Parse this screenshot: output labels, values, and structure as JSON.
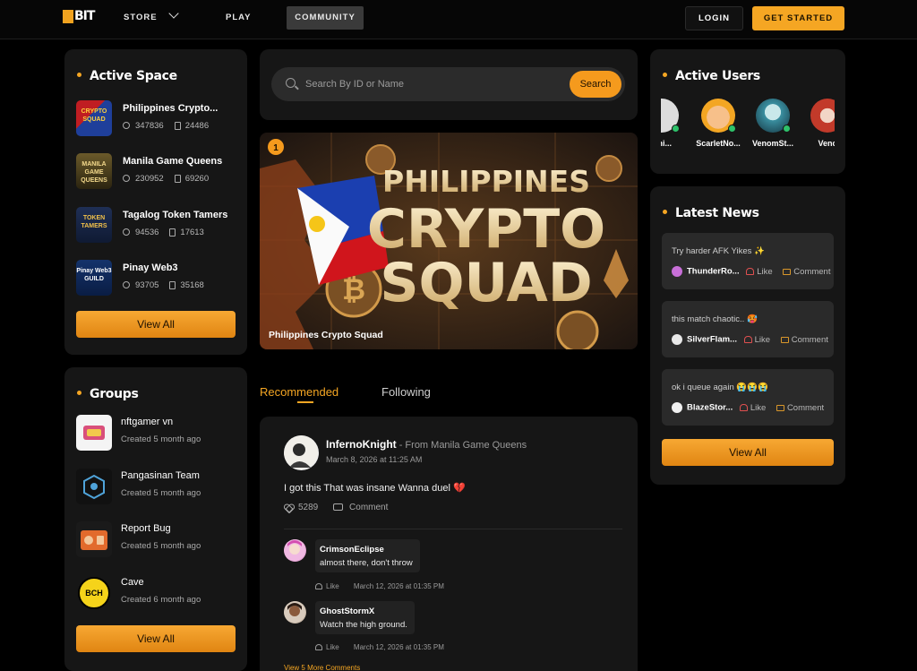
{
  "header": {
    "logo": "BIT",
    "nav": [
      {
        "label": "STORE"
      },
      {
        "label": "PLAY"
      },
      {
        "label": "COMMUNITY"
      }
    ],
    "login": "LOGIN",
    "get_started": "GET STARTED"
  },
  "active_space": {
    "title": "Active Space",
    "items": [
      {
        "name": "Philippines Crypto...",
        "members": "347836",
        "posts": "24486",
        "thumb_text": "CRYPTO SQUAD"
      },
      {
        "name": "Manila Game Queens",
        "members": "230952",
        "posts": "69260",
        "thumb_text": "MANILA GAME QUEENS"
      },
      {
        "name": "Tagalog Token Tamers",
        "members": "94536",
        "posts": "17613",
        "thumb_text": "TOKEN TAMERS"
      },
      {
        "name": "Pinay Web3",
        "members": "93705",
        "posts": "35168",
        "thumb_text": "Pinay Web3 GUILD"
      }
    ],
    "view_all": "View All"
  },
  "groups": {
    "title": "Groups",
    "items": [
      {
        "name": "nftgamer vn",
        "created": "Created 5 month ago"
      },
      {
        "name": "Pangasinan Team",
        "created": "Created 5 month ago"
      },
      {
        "name": "Report Bug",
        "created": "Created 5 month ago"
      },
      {
        "name": "Cave",
        "created": "Created 6 month ago",
        "thumb_text": "BCH"
      }
    ],
    "view_all": "View All"
  },
  "search": {
    "placeholder": "Search By ID or Name",
    "button": "Search"
  },
  "banner": {
    "badge": "1",
    "line1": "PHILIPPINES",
    "line2": "CRYPTO",
    "line3": "SQUAD",
    "caption": "Philippines Crypto Squad"
  },
  "tabs": {
    "recommended": "Recommended",
    "following": "Following"
  },
  "post": {
    "user": "InfernoKnight",
    "from": " - From Manila Game Queens",
    "date": "March 8, 2026 at 11:25 AM",
    "text": "I got this That was insane Wanna duel 💔",
    "likes": "5289",
    "comment_label": "Comment",
    "replies": [
      {
        "name": "CrimsonEclipse",
        "text": "almost there, don't throw",
        "like": "Like",
        "date": "March 12, 2026 at 01:35 PM"
      },
      {
        "name": "GhostStormX",
        "text": "Watch the high ground.",
        "like": "Like",
        "date": "March 12, 2026 at 01:35 PM"
      }
    ],
    "view_more": "View 5 More Comments"
  },
  "active_users": {
    "title": "Active Users",
    "users": [
      {
        "name": "Kni..."
      },
      {
        "name": "ScarletNo..."
      },
      {
        "name": "VenomSt..."
      },
      {
        "name": "Venc"
      }
    ]
  },
  "latest_news": {
    "title": "Latest News",
    "items": [
      {
        "text": "Try harder AFK Yikes ✨",
        "user": "ThunderRo...",
        "like": "Like",
        "comment": "Comment"
      },
      {
        "text": "this match chaotic.. 🥵",
        "user": "SilverFlam...",
        "like": "Like",
        "comment": "Comment"
      },
      {
        "text": "ok i queue again 😭😭😭",
        "user": "BlazeStor...",
        "like": "Like",
        "comment": "Comment"
      }
    ],
    "view_all": "View All"
  },
  "colors": {
    "accent": "#f5a623",
    "panel": "#161616",
    "online": "#2ec26a"
  }
}
